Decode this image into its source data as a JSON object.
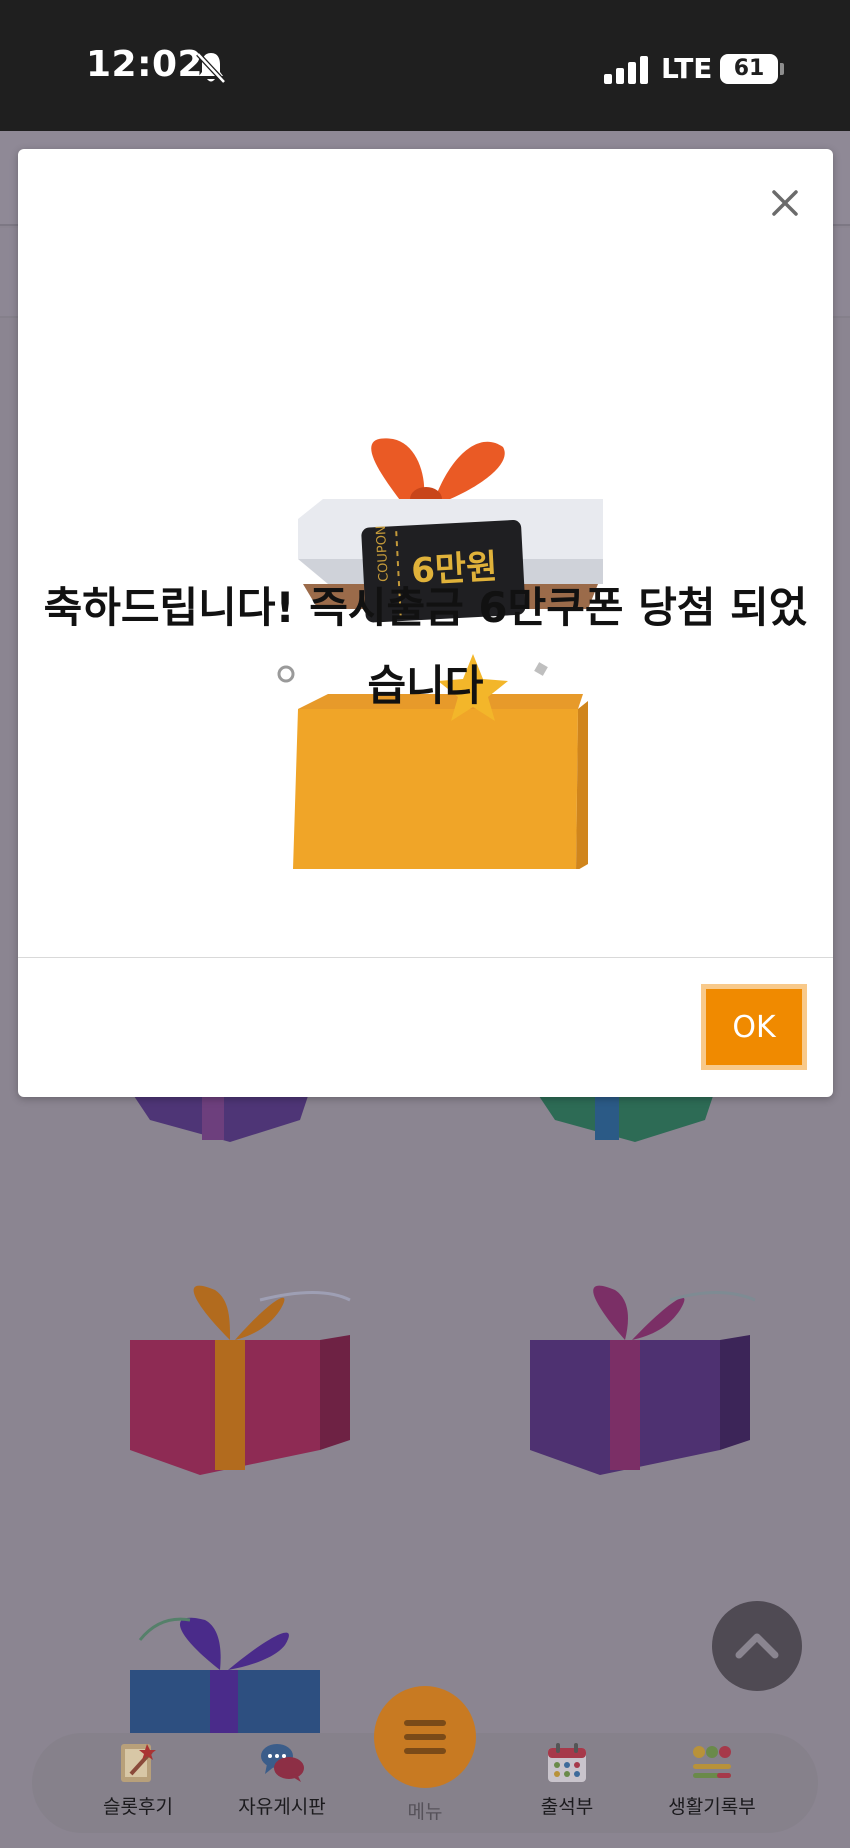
{
  "status_bar": {
    "time": "12:02",
    "network": "LTE",
    "battery": "61"
  },
  "modal": {
    "message": "축하드립니다! 즉시출금 6만쿠폰 당첨 되었습니다",
    "coupon_word": "COUPON",
    "coupon_amount": "6만원",
    "ok_label": "OK",
    "accent_color": "#f08a00"
  },
  "bottom_nav": {
    "items": [
      {
        "label": "슬롯후기",
        "icon": "review-note-icon"
      },
      {
        "label": "자유게시판",
        "icon": "chat-bubbles-icon"
      },
      {
        "label": "메뉴",
        "icon": "hamburger-menu-icon"
      },
      {
        "label": "출석부",
        "icon": "calendar-icon"
      },
      {
        "label": "생활기록부",
        "icon": "emoji-record-icon"
      }
    ]
  }
}
